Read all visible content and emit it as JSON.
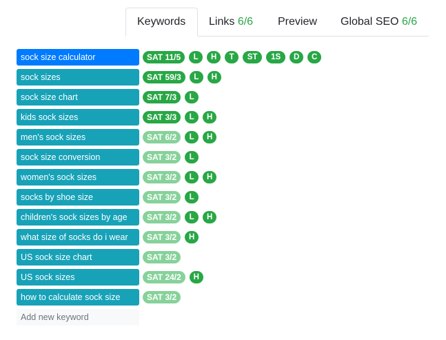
{
  "tabs": [
    {
      "label": "Keywords",
      "count": ""
    },
    {
      "label": "Links",
      "count": "6/6"
    },
    {
      "label": "Preview",
      "count": ""
    },
    {
      "label": "Global SEO",
      "count": "6/6"
    }
  ],
  "keywords": [
    {
      "label": "sock size calculator",
      "sat": "SAT 11/5",
      "sat_style": "dark",
      "tags": [
        "L",
        "H",
        "T",
        "ST",
        "1S",
        "D",
        "C"
      ],
      "active": true
    },
    {
      "label": "sock sizes",
      "sat": "SAT 59/3",
      "sat_style": "dark",
      "tags": [
        "L",
        "H"
      ]
    },
    {
      "label": "sock size chart",
      "sat": "SAT 7/3",
      "sat_style": "dark",
      "tags": [
        "L"
      ]
    },
    {
      "label": "kids sock sizes",
      "sat": "SAT 3/3",
      "sat_style": "dark",
      "tags": [
        "L",
        "H"
      ]
    },
    {
      "label": "men's sock sizes",
      "sat": "SAT 6/2",
      "sat_style": "light",
      "tags": [
        "L",
        "H"
      ]
    },
    {
      "label": "sock size conversion",
      "sat": "SAT 3/2",
      "sat_style": "light",
      "tags": [
        "L"
      ]
    },
    {
      "label": "women's sock sizes",
      "sat": "SAT 3/2",
      "sat_style": "light",
      "tags": [
        "L",
        "H"
      ]
    },
    {
      "label": "socks by shoe size",
      "sat": "SAT 3/2",
      "sat_style": "light",
      "tags": [
        "L"
      ]
    },
    {
      "label": "children's sock sizes by age",
      "sat": "SAT 3/2",
      "sat_style": "light",
      "tags": [
        "L",
        "H"
      ]
    },
    {
      "label": "what size of socks do i wear",
      "sat": "SAT 3/2",
      "sat_style": "light",
      "tags": [
        "H"
      ]
    },
    {
      "label": "US sock size chart",
      "sat": "SAT 3/2",
      "sat_style": "light",
      "tags": []
    },
    {
      "label": "US sock sizes",
      "sat": "SAT 24/2",
      "sat_style": "light",
      "tags": [
        "H"
      ]
    },
    {
      "label": "how to calculate sock size",
      "sat": "SAT 3/2",
      "sat_style": "light",
      "tags": []
    }
  ],
  "add_keyword": {
    "placeholder": "Add new keyword"
  },
  "colors": {
    "active_keyword": "#007bff",
    "keyword": "#17a2b8",
    "sat_dark": "#28a745",
    "sat_light": "#86d29a",
    "count": "#28a745"
  }
}
